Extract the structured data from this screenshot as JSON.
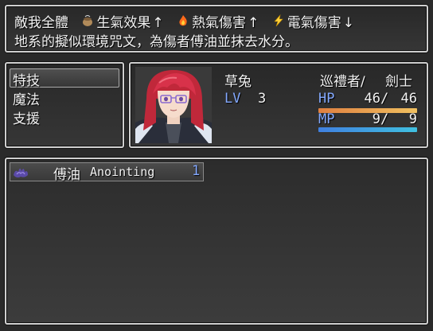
{
  "help": {
    "line1": {
      "target": "敵我全體",
      "effects": [
        {
          "icon": "pot-icon",
          "label": "生氣效果",
          "arrow": "↑"
        },
        {
          "icon": "fire-icon",
          "label": "熱氣傷害",
          "arrow": "↑"
        },
        {
          "icon": "lightning-icon",
          "label": "電氣傷害",
          "arrow": "↓"
        }
      ]
    },
    "line2": "地系的擬似環境咒文，為傷者傅油並抹去水分。"
  },
  "commands": [
    {
      "label": "特技",
      "selected": true
    },
    {
      "label": "魔法",
      "selected": false
    },
    {
      "label": "支援",
      "selected": false
    }
  ],
  "actor": {
    "name": "草兔",
    "class": "巡禮者/",
    "subclass": "劍士",
    "lv_label": "LV",
    "level": "3",
    "hp_label": "HP",
    "hp": "46",
    "hp_max": "46",
    "hp_ratio": 1.0,
    "mp_label": "MP",
    "mp": "9",
    "mp_max": "9",
    "mp_ratio": 1.0,
    "slash": "/"
  },
  "skills": [
    {
      "icon": "water-splash-icon",
      "name": "傅油",
      "en_name": "Anointing",
      "cost": "1"
    }
  ],
  "colors": {
    "hp_gauge_start": "#e08040",
    "hp_gauge_end": "#f0c060",
    "mp_gauge_start": "#4080e0",
    "mp_gauge_end": "#40c0e0",
    "system_blue": "#84a9ff"
  }
}
